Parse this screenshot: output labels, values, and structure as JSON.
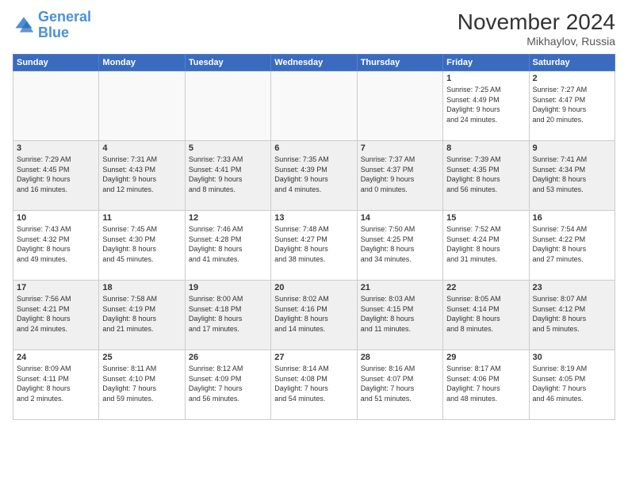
{
  "logo": {
    "line1": "General",
    "line2": "Blue"
  },
  "title": "November 2024",
  "location": "Mikhaylov, Russia",
  "days_of_week": [
    "Sunday",
    "Monday",
    "Tuesday",
    "Wednesday",
    "Thursday",
    "Friday",
    "Saturday"
  ],
  "weeks": [
    {
      "shaded": false,
      "days": [
        {
          "num": "",
          "info": ""
        },
        {
          "num": "",
          "info": ""
        },
        {
          "num": "",
          "info": ""
        },
        {
          "num": "",
          "info": ""
        },
        {
          "num": "",
          "info": ""
        },
        {
          "num": "1",
          "info": "Sunrise: 7:25 AM\nSunset: 4:49 PM\nDaylight: 9 hours\nand 24 minutes."
        },
        {
          "num": "2",
          "info": "Sunrise: 7:27 AM\nSunset: 4:47 PM\nDaylight: 9 hours\nand 20 minutes."
        }
      ]
    },
    {
      "shaded": true,
      "days": [
        {
          "num": "3",
          "info": "Sunrise: 7:29 AM\nSunset: 4:45 PM\nDaylight: 9 hours\nand 16 minutes."
        },
        {
          "num": "4",
          "info": "Sunrise: 7:31 AM\nSunset: 4:43 PM\nDaylight: 9 hours\nand 12 minutes."
        },
        {
          "num": "5",
          "info": "Sunrise: 7:33 AM\nSunset: 4:41 PM\nDaylight: 9 hours\nand 8 minutes."
        },
        {
          "num": "6",
          "info": "Sunrise: 7:35 AM\nSunset: 4:39 PM\nDaylight: 9 hours\nand 4 minutes."
        },
        {
          "num": "7",
          "info": "Sunrise: 7:37 AM\nSunset: 4:37 PM\nDaylight: 9 hours\nand 0 minutes."
        },
        {
          "num": "8",
          "info": "Sunrise: 7:39 AM\nSunset: 4:35 PM\nDaylight: 8 hours\nand 56 minutes."
        },
        {
          "num": "9",
          "info": "Sunrise: 7:41 AM\nSunset: 4:34 PM\nDaylight: 8 hours\nand 53 minutes."
        }
      ]
    },
    {
      "shaded": false,
      "days": [
        {
          "num": "10",
          "info": "Sunrise: 7:43 AM\nSunset: 4:32 PM\nDaylight: 8 hours\nand 49 minutes."
        },
        {
          "num": "11",
          "info": "Sunrise: 7:45 AM\nSunset: 4:30 PM\nDaylight: 8 hours\nand 45 minutes."
        },
        {
          "num": "12",
          "info": "Sunrise: 7:46 AM\nSunset: 4:28 PM\nDaylight: 8 hours\nand 41 minutes."
        },
        {
          "num": "13",
          "info": "Sunrise: 7:48 AM\nSunset: 4:27 PM\nDaylight: 8 hours\nand 38 minutes."
        },
        {
          "num": "14",
          "info": "Sunrise: 7:50 AM\nSunset: 4:25 PM\nDaylight: 8 hours\nand 34 minutes."
        },
        {
          "num": "15",
          "info": "Sunrise: 7:52 AM\nSunset: 4:24 PM\nDaylight: 8 hours\nand 31 minutes."
        },
        {
          "num": "16",
          "info": "Sunrise: 7:54 AM\nSunset: 4:22 PM\nDaylight: 8 hours\nand 27 minutes."
        }
      ]
    },
    {
      "shaded": true,
      "days": [
        {
          "num": "17",
          "info": "Sunrise: 7:56 AM\nSunset: 4:21 PM\nDaylight: 8 hours\nand 24 minutes."
        },
        {
          "num": "18",
          "info": "Sunrise: 7:58 AM\nSunset: 4:19 PM\nDaylight: 8 hours\nand 21 minutes."
        },
        {
          "num": "19",
          "info": "Sunrise: 8:00 AM\nSunset: 4:18 PM\nDaylight: 8 hours\nand 17 minutes."
        },
        {
          "num": "20",
          "info": "Sunrise: 8:02 AM\nSunset: 4:16 PM\nDaylight: 8 hours\nand 14 minutes."
        },
        {
          "num": "21",
          "info": "Sunrise: 8:03 AM\nSunset: 4:15 PM\nDaylight: 8 hours\nand 11 minutes."
        },
        {
          "num": "22",
          "info": "Sunrise: 8:05 AM\nSunset: 4:14 PM\nDaylight: 8 hours\nand 8 minutes."
        },
        {
          "num": "23",
          "info": "Sunrise: 8:07 AM\nSunset: 4:12 PM\nDaylight: 8 hours\nand 5 minutes."
        }
      ]
    },
    {
      "shaded": false,
      "days": [
        {
          "num": "24",
          "info": "Sunrise: 8:09 AM\nSunset: 4:11 PM\nDaylight: 8 hours\nand 2 minutes."
        },
        {
          "num": "25",
          "info": "Sunrise: 8:11 AM\nSunset: 4:10 PM\nDaylight: 7 hours\nand 59 minutes."
        },
        {
          "num": "26",
          "info": "Sunrise: 8:12 AM\nSunset: 4:09 PM\nDaylight: 7 hours\nand 56 minutes."
        },
        {
          "num": "27",
          "info": "Sunrise: 8:14 AM\nSunset: 4:08 PM\nDaylight: 7 hours\nand 54 minutes."
        },
        {
          "num": "28",
          "info": "Sunrise: 8:16 AM\nSunset: 4:07 PM\nDaylight: 7 hours\nand 51 minutes."
        },
        {
          "num": "29",
          "info": "Sunrise: 8:17 AM\nSunset: 4:06 PM\nDaylight: 7 hours\nand 48 minutes."
        },
        {
          "num": "30",
          "info": "Sunrise: 8:19 AM\nSunset: 4:05 PM\nDaylight: 7 hours\nand 46 minutes."
        }
      ]
    }
  ]
}
